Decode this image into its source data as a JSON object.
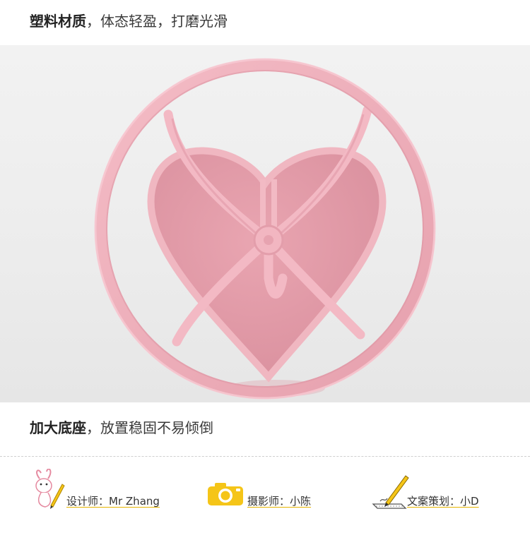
{
  "top_caption": {
    "bold": "塑料材质",
    "rest": "，体态轻盈，打磨光滑"
  },
  "bottom_caption": {
    "bold": "加大底座",
    "rest": "，放置稳固不易倾倒"
  },
  "credits": [
    {
      "role": "设计师",
      "sep": "：",
      "name": "Mr Zhang",
      "icon": "bunny-pencil-icon"
    },
    {
      "role": "摄影师",
      "sep": "：",
      "name": "小陈",
      "icon": "camera-icon"
    },
    {
      "role": "文案策划",
      "sep": "：",
      "name": "小D",
      "icon": "pencil-paper-icon"
    }
  ],
  "colors": {
    "product_pink": "#eaa9b4",
    "accent_yellow": "#f5c518",
    "background": "#ffffff"
  }
}
